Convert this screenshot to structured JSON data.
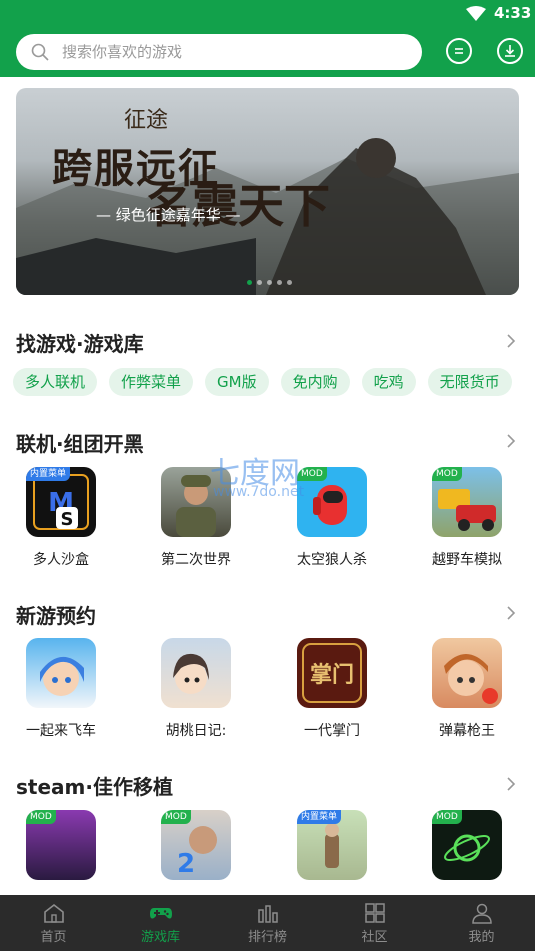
{
  "status_bar": {
    "time": "4:33"
  },
  "search": {
    "placeholder": "搜索你喜欢的游戏"
  },
  "banner": {
    "logo_text": "征途",
    "headline_1": "跨服远征",
    "headline_2": "名震天下",
    "subtitle": "— 绿色征途嘉年华 —",
    "slide_count": 5,
    "active_slide": 1
  },
  "sections": {
    "library": {
      "title": "找游戏·游戏库",
      "tags": [
        "多人联机",
        "作弊菜单",
        "GM版",
        "免内购",
        "吃鸡",
        "无限货币"
      ]
    },
    "multiplayer": {
      "title": "联机·组团开黑",
      "apps": [
        {
          "name": "多人沙盒",
          "badge": "内置菜单"
        },
        {
          "name": "第二次世界",
          "badge": ""
        },
        {
          "name": "太空狼人杀",
          "badge": "MOD"
        },
        {
          "name": "越野车模拟",
          "badge": "MOD"
        }
      ]
    },
    "new_games": {
      "title": "新游预约",
      "apps": [
        {
          "name": "一起来飞车",
          "badge": ""
        },
        {
          "name": "胡桃日记:",
          "badge": ""
        },
        {
          "name": "一代掌门",
          "badge": ""
        },
        {
          "name": "弹幕枪王",
          "badge": ""
        }
      ]
    },
    "steam": {
      "title": "steam·佳作移植",
      "apps": [
        {
          "name": "",
          "badge": "MOD"
        },
        {
          "name": "",
          "badge": "MOD"
        },
        {
          "name": "",
          "badge": "内置菜单"
        },
        {
          "name": "",
          "badge": "MOD"
        }
      ]
    }
  },
  "watermark": {
    "line1": "七度网",
    "line2": "www.7do.net"
  },
  "tabbar": {
    "items": [
      {
        "label": "首页",
        "icon": "home-icon"
      },
      {
        "label": "游戏库",
        "icon": "gamepad-icon"
      },
      {
        "label": "排行榜",
        "icon": "ranking-icon"
      },
      {
        "label": "社区",
        "icon": "community-icon"
      },
      {
        "label": "我的",
        "icon": "profile-icon"
      }
    ],
    "active": "游戏库"
  },
  "colors": {
    "brand": "#12a14b",
    "tag_bg": "#e5f4ea",
    "tabbar_bg": "#2b2b2b"
  }
}
